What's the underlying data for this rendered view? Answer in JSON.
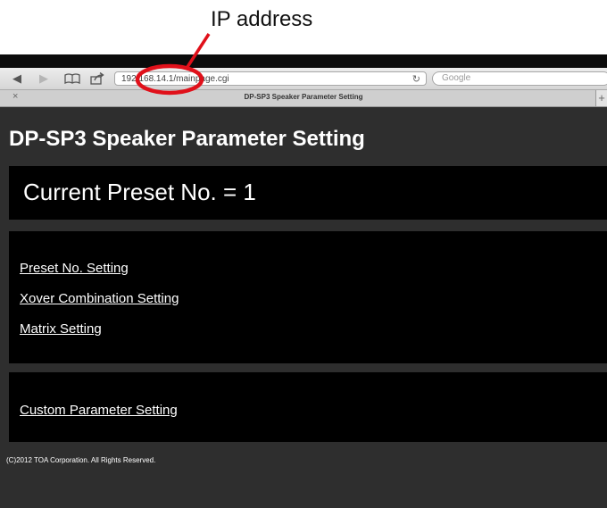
{
  "annotation": {
    "label": "IP address"
  },
  "browser": {
    "url": "192.168.14.1/mainpage.cgi",
    "search_placeholder": "Google",
    "tab_title": "DP-SP3 Speaker Parameter Setting",
    "icons": [
      "back-icon",
      "forward-icon",
      "bookmarks-icon",
      "share-icon",
      "reload-icon",
      "close-icon",
      "new-tab-icon"
    ]
  },
  "page": {
    "title": "DP-SP3 Speaker Parameter Setting",
    "current_preset": "Current Preset No. = 1",
    "links": {
      "preset": "Preset No. Setting",
      "xover": "Xover Combination Setting",
      "matrix": "Matrix Setting",
      "custom": "Custom Parameter Setting"
    },
    "footer": "(C)2012 TOA Corporation. All Rights Reserved."
  },
  "colors": {
    "page_bg": "#2e2e2e",
    "panel_bg": "#000000",
    "annotation_red": "#e0101a",
    "text": "#ffffff"
  }
}
